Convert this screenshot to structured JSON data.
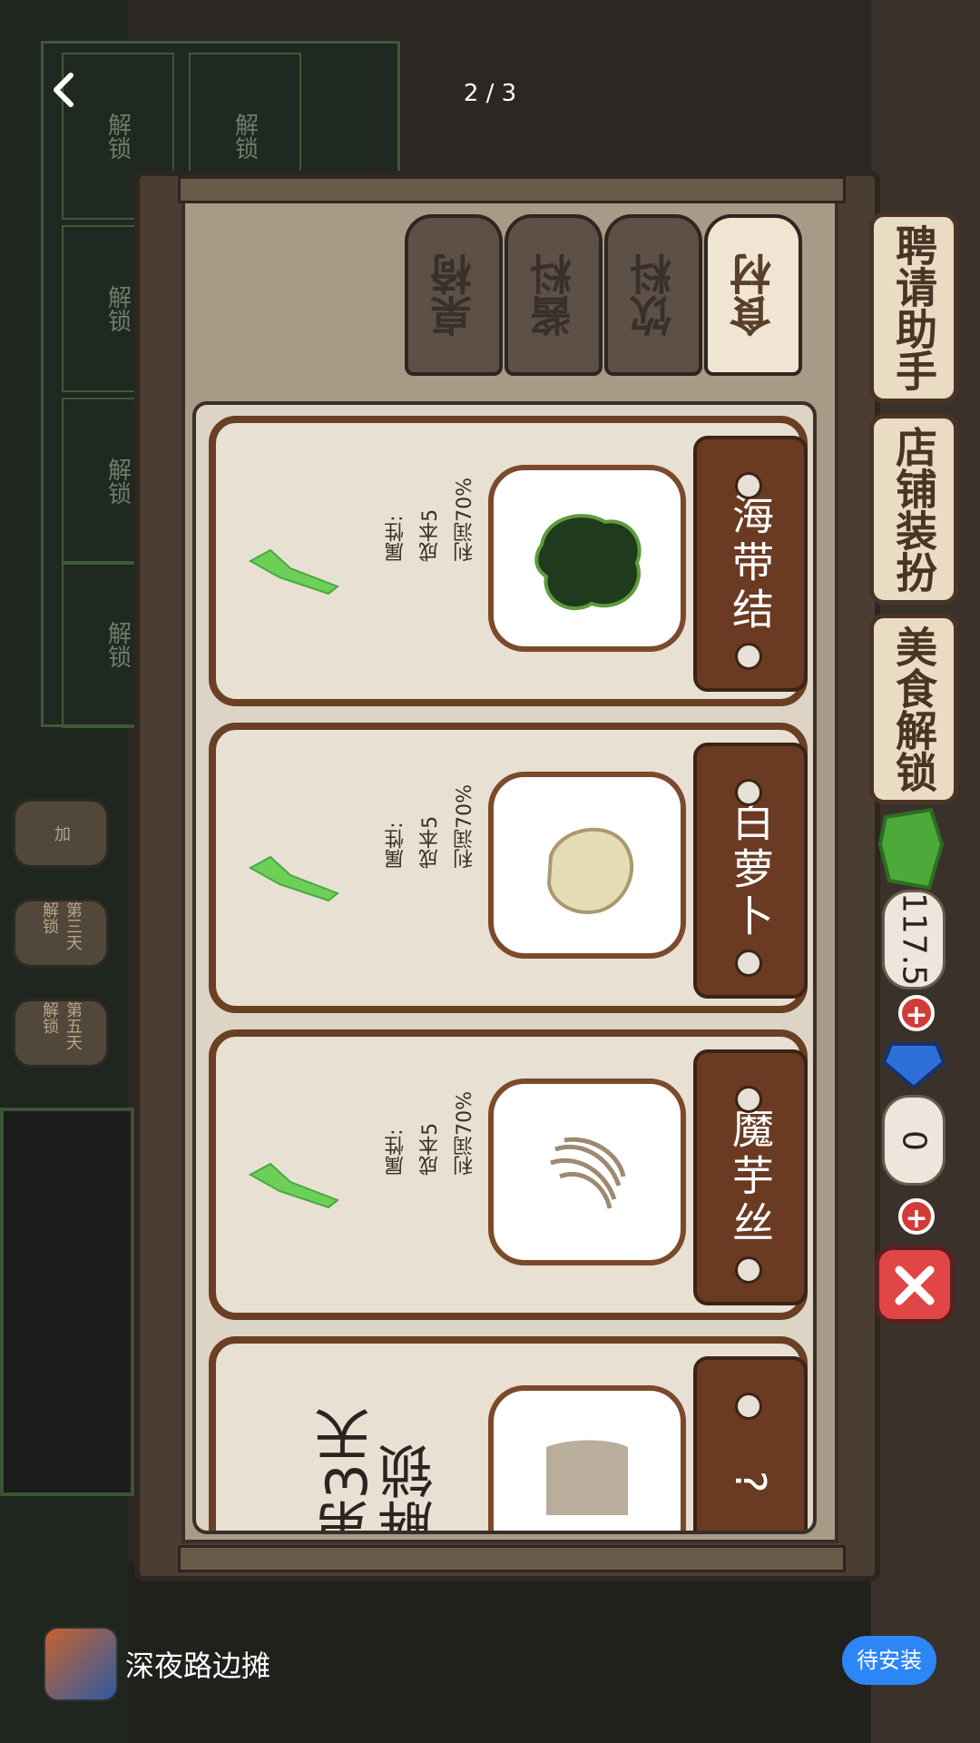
{
  "top_bar": {
    "page_counter": "2 / 3"
  },
  "background": {
    "grid_labels": [
      "解锁",
      "解锁",
      "解锁",
      "解锁",
      "解锁",
      "解锁"
    ],
    "pots": [
      "加",
      "第三天解锁",
      "第五天解锁"
    ]
  },
  "tabs": [
    {
      "label": "食材",
      "active": true
    },
    {
      "label": "饮料",
      "active": false
    },
    {
      "label": "酱料",
      "active": false
    },
    {
      "label": "桌椅",
      "active": false
    }
  ],
  "items": [
    {
      "name": "海带结",
      "attr_title": "属性:",
      "cost": "成本5",
      "profit": "利润70%",
      "unlocked": true,
      "icon": "kelp-knot-icon"
    },
    {
      "name": "白萝卜",
      "attr_title": "属性:",
      "cost": "成本5",
      "profit": "利润70%",
      "unlocked": true,
      "icon": "radish-icon"
    },
    {
      "name": "魔芋丝",
      "attr_title": "属性:",
      "cost": "成本5",
      "profit": "利润70%",
      "unlocked": true,
      "icon": "konjac-noodle-icon"
    },
    {
      "name": "?",
      "lock_line1": "第3天",
      "lock_line2": "解锁",
      "unlocked": false,
      "icon": "locked-item-icon"
    }
  ],
  "side_menu": {
    "hire_assistant": "聘请助手",
    "shop_decor": "店铺装扮",
    "food_unlock": "美食解锁"
  },
  "currency": {
    "cash": "117.5",
    "gems": "0"
  },
  "colors": {
    "wood_dark": "#4a3d32",
    "card_border": "#6a3f24",
    "check_green": "#6ccf58",
    "close_red": "#e04646",
    "install_blue": "#2d86f5"
  },
  "footer": {
    "app_name": "深夜路边摊",
    "install_label": "待安装"
  }
}
